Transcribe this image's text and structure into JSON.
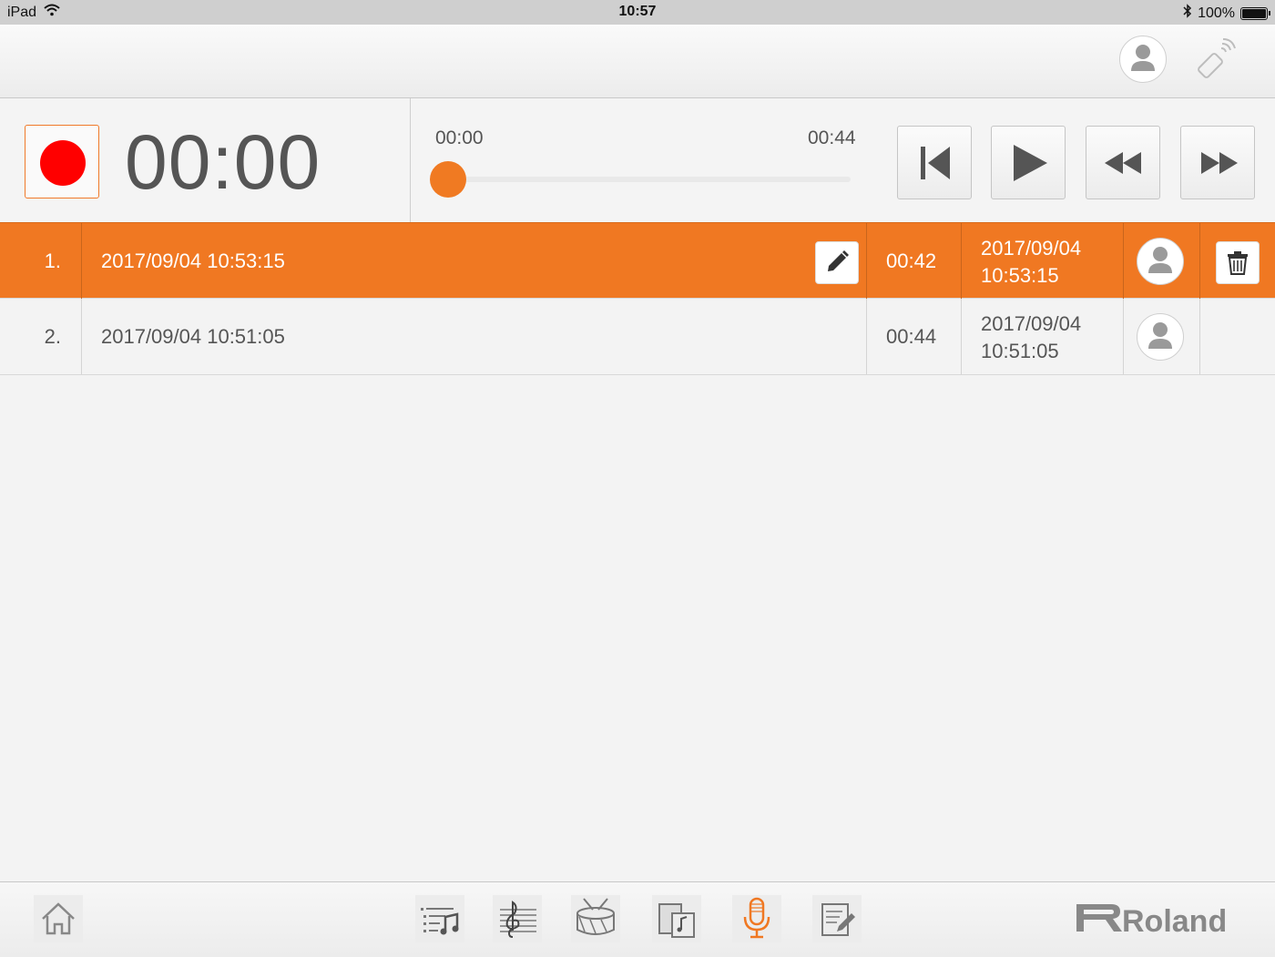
{
  "status_bar": {
    "device": "iPad",
    "time": "10:57",
    "battery": "100%"
  },
  "header": {
    "profile_icon": "person-icon",
    "remote_icon": "remote-control-icon"
  },
  "transport": {
    "record_time": "00:00",
    "position_start": "00:00",
    "position_end": "00:44",
    "position_fraction": 0,
    "buttons": [
      "skip-to-start-icon",
      "play-icon",
      "rewind-icon",
      "fast-forward-icon"
    ]
  },
  "recordings": [
    {
      "index": "1.",
      "name": "2017/09/04 10:53:15",
      "duration": "00:42",
      "date": "2017/09/04",
      "time": "10:53:15",
      "selected": true
    },
    {
      "index": "2.",
      "name": "2017/09/04 10:51:05",
      "duration": "00:44",
      "date": "2017/09/04",
      "time": "10:51:05",
      "selected": false
    }
  ],
  "toolbar": {
    "items": [
      "home-icon",
      "song-list-icon",
      "score-icon",
      "drum-icon",
      "flash-card-icon",
      "microphone-icon",
      "notepad-icon"
    ],
    "active": "microphone-icon",
    "brand": "Roland"
  },
  "colors": {
    "accent": "#f07822",
    "record": "#ff0000",
    "background": "#f3f3f3"
  }
}
